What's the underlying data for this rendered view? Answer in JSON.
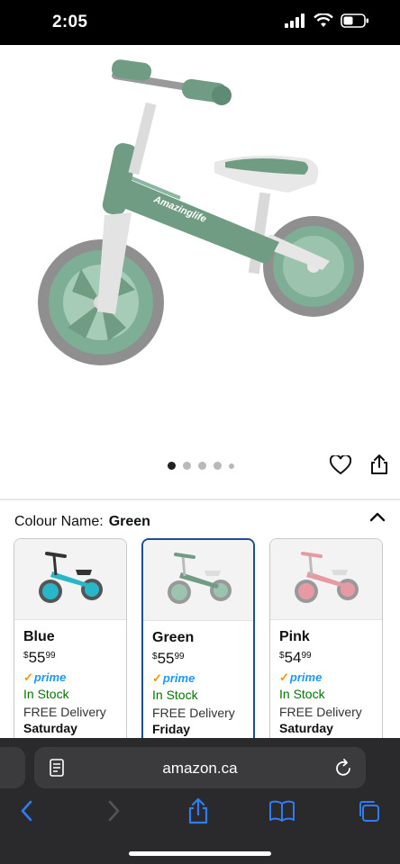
{
  "status_bar": {
    "time": "2:05"
  },
  "product": {
    "brand_on_frame": "Amazinglife",
    "image_dots": 5,
    "active_dot": 0
  },
  "colour": {
    "label": "Colour Name:",
    "value": "Green"
  },
  "variants": [
    {
      "name": "Blue",
      "currency": "$",
      "price_whole": "55",
      "price_cents": "99",
      "prime": "prime",
      "stock": "In Stock",
      "delivery": "FREE Delivery",
      "day": "Saturday",
      "color": "#27b7c9"
    },
    {
      "name": "Green",
      "currency": "$",
      "price_whole": "55",
      "price_cents": "99",
      "prime": "prime",
      "stock": "In Stock",
      "delivery": "FREE Delivery",
      "day": "Friday",
      "color": "#6f9c82"
    },
    {
      "name": "Pink",
      "currency": "$",
      "price_whole": "54",
      "price_cents": "99",
      "prime": "prime",
      "stock": "In Stock",
      "delivery": "FREE Delivery",
      "day": "Saturday",
      "color": "#e89aa3"
    }
  ],
  "browser": {
    "url": "amazon.ca"
  },
  "colors": {
    "link": "#2f7cf6",
    "prime_blue": "#1a98ff",
    "in_stock": "#007600",
    "selected_border": "#1d4f91"
  }
}
